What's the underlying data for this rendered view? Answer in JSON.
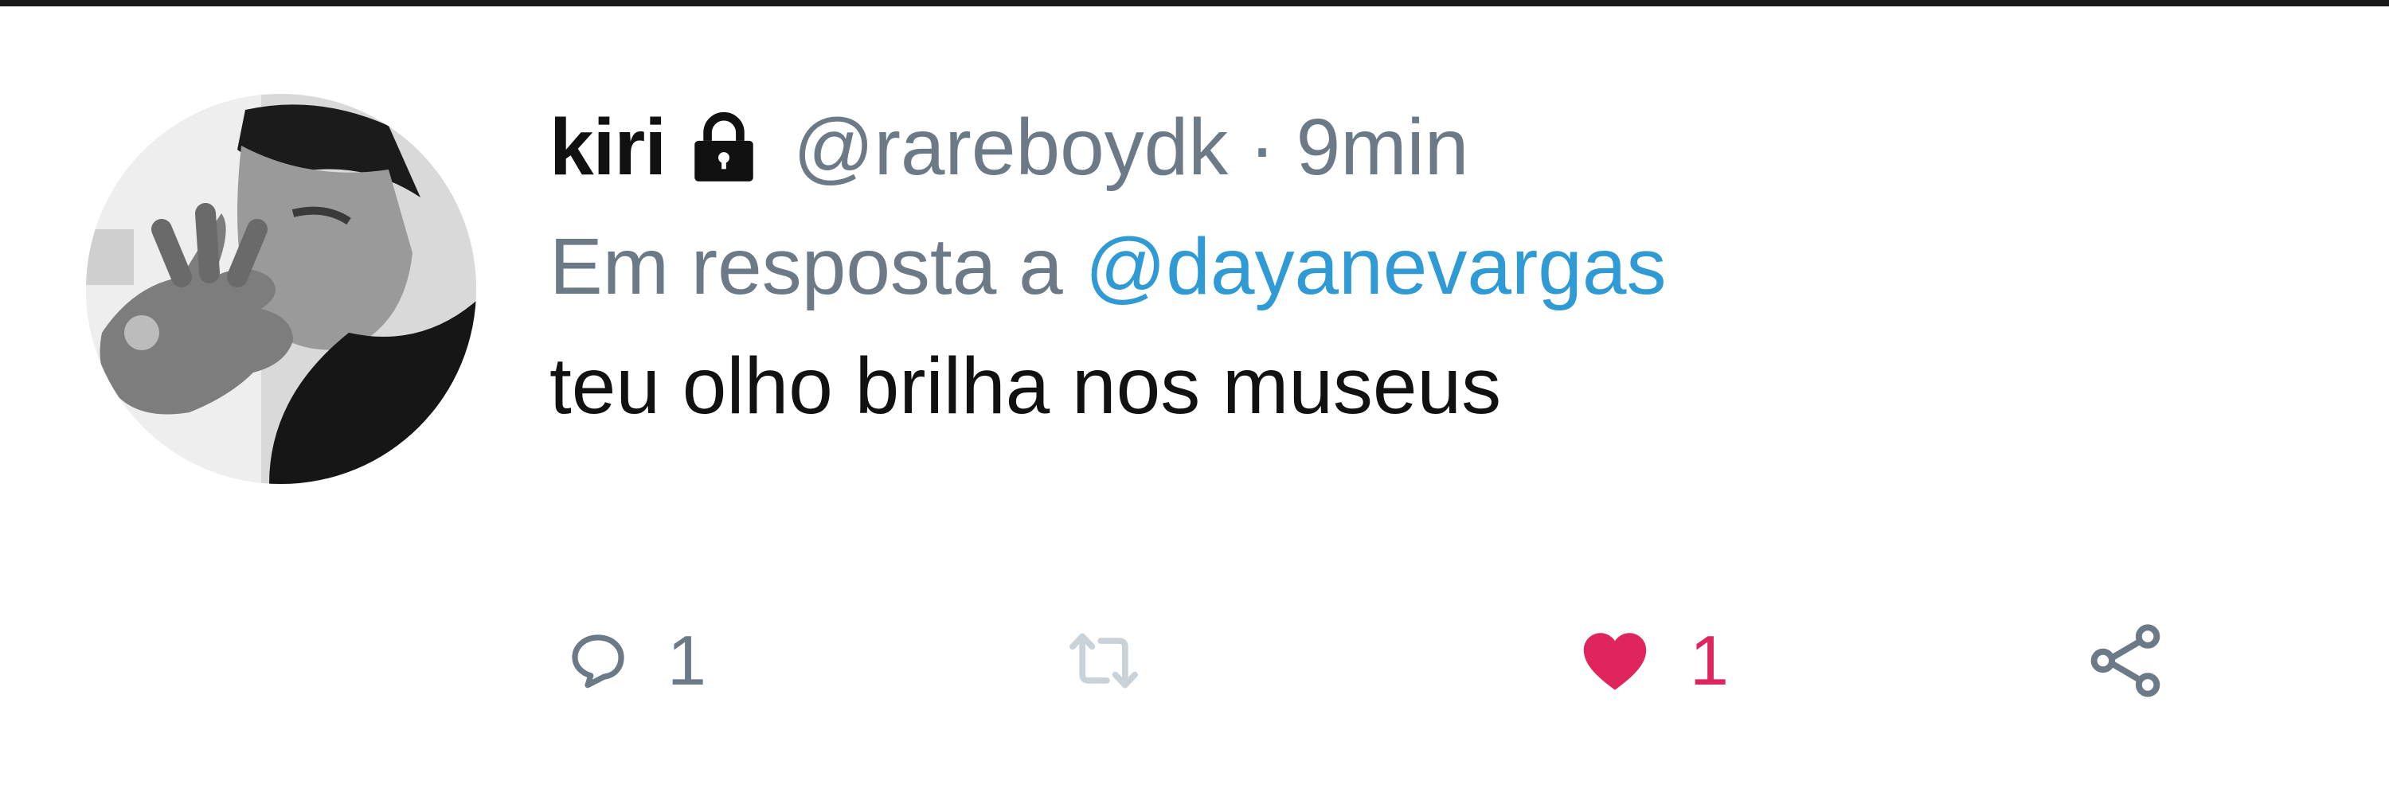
{
  "tweet": {
    "display_name": "kiri",
    "handle": "@rareboydk",
    "separator": "·",
    "time": "9min",
    "reply_prefix": "Em resposta a",
    "reply_to": "@dayanevargas",
    "text": "teu olho brilha nos museus",
    "author_protected": true
  },
  "actions": {
    "reply": {
      "icon": "reply-icon",
      "count": "1"
    },
    "retweet": {
      "icon": "retweet-icon",
      "count": "",
      "disabled": true
    },
    "like": {
      "icon": "heart-icon",
      "count": "1",
      "liked": true
    },
    "share": {
      "icon": "share-icon"
    }
  },
  "colors": {
    "secondary_text": "#6b7a86",
    "link": "#2f9ad3",
    "like": "#e0245e",
    "disabled": "#c9d2d9",
    "primary_text": "#111111"
  }
}
